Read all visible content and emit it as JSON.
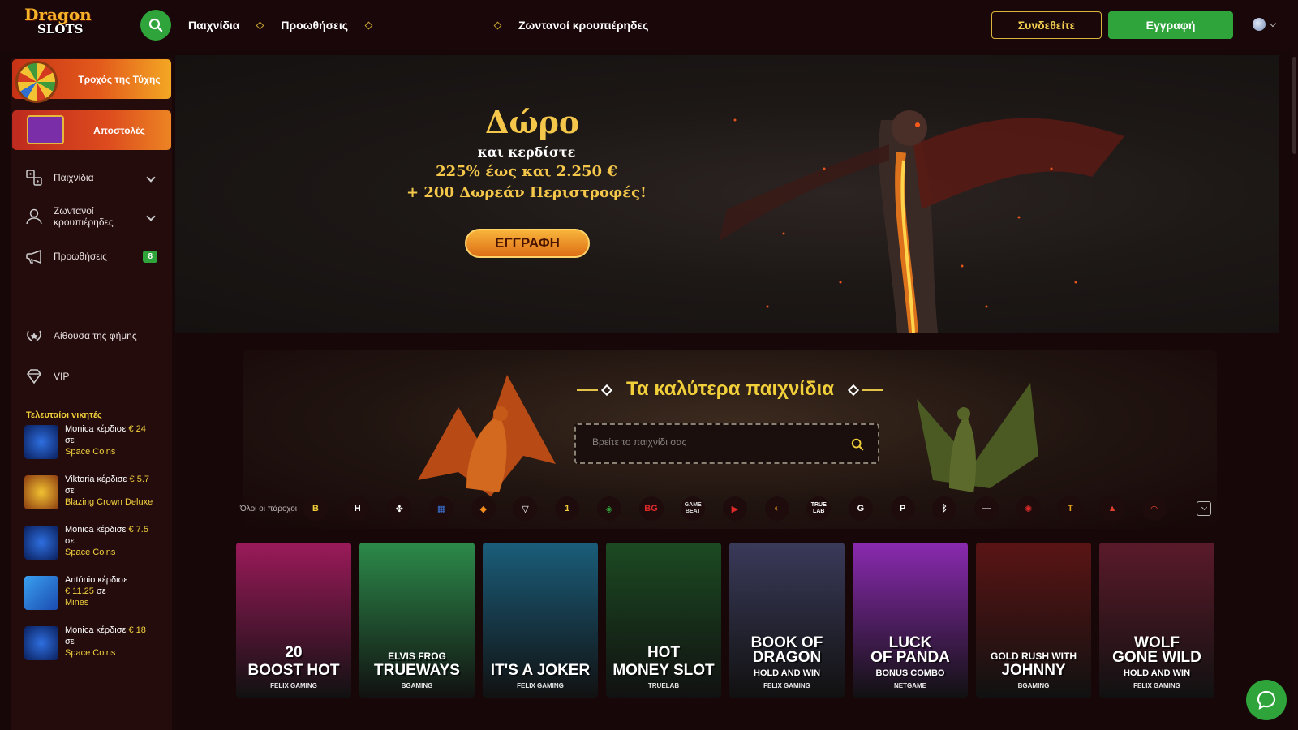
{
  "logo": {
    "line1": "Dragon",
    "line2": "SLOTS"
  },
  "topnav": {
    "games": "Παιχνίδια",
    "promotions": "Προωθήσεις",
    "live": "Ζωντανοί κρουπιέρηδες"
  },
  "auth": {
    "login": "Συνδεθείτε",
    "register": "Εγγραφή"
  },
  "sidebar": {
    "wheel": "Τροχός της Τύχης",
    "missions": "Αποστολές",
    "games": "Παιχνίδια",
    "live": "Ζωντανοί κρουπιέρηδες",
    "promotions": "Προωθήσεις",
    "promotions_badge": "8",
    "hall": "Αίθουσα της φήμης",
    "vip": "VIP",
    "winners_title": "Τελευταίοι νικητές",
    "winners": [
      {
        "text": "Monica κέρδισε",
        "amount": "€ 24",
        "in": "σε",
        "game": "Space Coins"
      },
      {
        "text": "Viktoria κέρδισε",
        "amount": "€ 5.7",
        "in": "σε",
        "game": "Blazing Crown Deluxe"
      },
      {
        "text": "Monica κέρδισε",
        "amount": "€ 7.5",
        "in": "σε",
        "game": "Space Coins"
      },
      {
        "text": "António κέρδισε",
        "amount": "€ 11.25",
        "in": "σε",
        "game": "Mines"
      },
      {
        "text": "Monica κέρδισε",
        "amount": "€ 18",
        "in": "σε",
        "game": "Space Coins"
      }
    ]
  },
  "hero": {
    "title": "Δώρο",
    "line1": "και κερδίστε",
    "line2": "225% έως και 2.250 €",
    "line3": "+ 200 Δωρεάν Περιστροφές!",
    "button": "ΕΓΓΡΑΦΗ"
  },
  "best": {
    "title": "Τα καλύτερα παιχνίδια",
    "search_placeholder": "Βρείτε το παιχνίδι σας"
  },
  "providers": {
    "all_label": "Όλοι οι πάροχοι",
    "items": [
      {
        "name": "B",
        "color": "#f1cf3b"
      },
      {
        "name": "H",
        "color": "#ffffff"
      },
      {
        "name": "✤",
        "color": "#ffffff"
      },
      {
        "name": "▦",
        "color": "#3b78e0"
      },
      {
        "name": "◆",
        "color": "#f08a1c"
      },
      {
        "name": "▽",
        "color": "#ffffff"
      },
      {
        "name": "1",
        "color": "#f1cf3b"
      },
      {
        "name": "◈",
        "color": "#2ea43b"
      },
      {
        "name": "BG",
        "color": "#e02a2a"
      },
      {
        "name": "GAME BEAT",
        "color": "#dddddd"
      },
      {
        "name": "▶",
        "color": "#e02a2a"
      },
      {
        "name": "◐",
        "color": "#f1a51c"
      },
      {
        "name": "TRUE LAB",
        "color": "#ffffff"
      },
      {
        "name": "G",
        "color": "#ffffff"
      },
      {
        "name": "P",
        "color": "#ffffff"
      },
      {
        "name": "ᛒ",
        "color": "#ffffff"
      },
      {
        "name": "—",
        "color": "#dddddd"
      },
      {
        "name": "✺",
        "color": "#e02a2a"
      },
      {
        "name": "T",
        "color": "#e0a11c"
      },
      {
        "name": "▲",
        "color": "#e0402a"
      },
      {
        "name": "◠",
        "color": "#e0402a"
      }
    ]
  },
  "games": [
    {
      "l1": "20",
      "l2": "BOOST HOT",
      "provider": "FELIX GAMING",
      "bg": "#9b1a5a"
    },
    {
      "l1": "ELVIS FROG",
      "l2": "TRUEWAYS",
      "provider": "BGAMING",
      "bg": "#2c8a4a"
    },
    {
      "l1": "",
      "l2": "IT'S A JOKER",
      "provider": "FELIX GAMING",
      "bg": "#1a5d7a"
    },
    {
      "l1": "HOT",
      "l2": "MONEY SLOT",
      "provider": "TRUELAB",
      "bg": "#1c4a22"
    },
    {
      "l1": "BOOK OF",
      "l2": "DRAGON",
      "l3": "HOLD AND WIN",
      "provider": "FELIX GAMING",
      "bg": "#3a3a5a"
    },
    {
      "l1": "LUCK",
      "l2": "OF PANDA",
      "l3": "BONUS COMBO",
      "provider": "NETGAME",
      "bg": "#8a2ab0"
    },
    {
      "l1": "GOLD RUSH WITH",
      "l2": "JOHNNY",
      "provider": "BGAMING",
      "bg": "#5a1414"
    },
    {
      "l1": "WOLF",
      "l2": "GONE WILD",
      "l3": "HOLD AND WIN",
      "provider": "FELIX GAMING",
      "bg": "#5a1a2a"
    }
  ]
}
